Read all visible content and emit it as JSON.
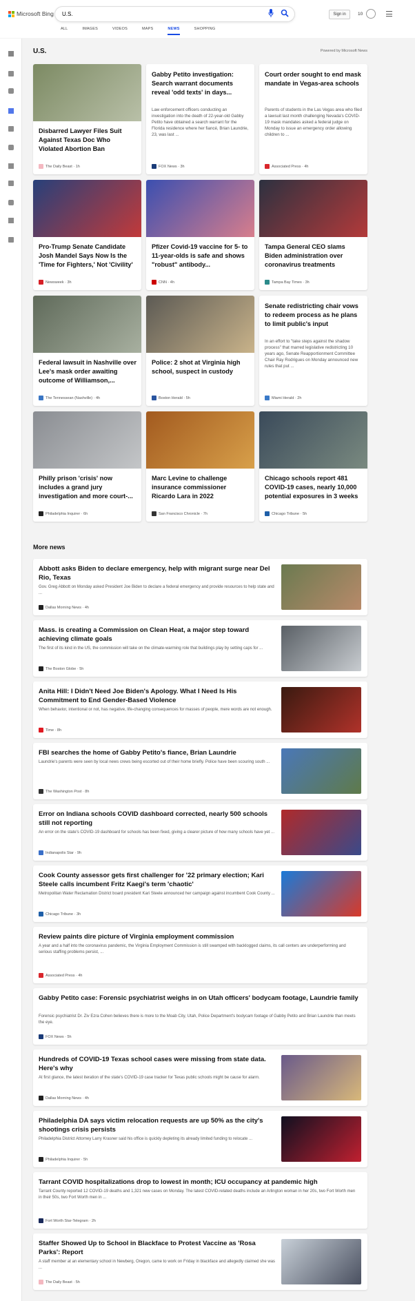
{
  "brand": {
    "name": "Microsoft Bing",
    "colors": [
      "#f25022",
      "#7fba00",
      "#00a4ef",
      "#ffb900"
    ]
  },
  "search": {
    "query": "U.S."
  },
  "header": {
    "signin_label": "Sign in",
    "points": "10"
  },
  "tabs": [
    {
      "label": "ALL"
    },
    {
      "label": "IMAGES"
    },
    {
      "label": "VIDEOS"
    },
    {
      "label": "MAPS"
    },
    {
      "label": "NEWS",
      "active": true
    },
    {
      "label": "SHOPPING"
    }
  ],
  "accent": "#174ae4",
  "rail_icons": [
    "chevron-right-icon",
    "home-icon",
    "sparkle-icon",
    "flag-icon",
    "pin-icon",
    "globe-icon",
    "flask-icon",
    "rocket-icon",
    "film-icon",
    "bank-icon",
    "card-icon"
  ],
  "section": {
    "title": "U.S.",
    "powered_by": "Powered by Microsoft News"
  },
  "top_cards": [
    {
      "title": "Disbarred Lawyer Files Suit Against Texas Doc Who Violated Abortion Ban",
      "source": "The Daily Beast",
      "time": "1h",
      "src_color": "#f4b8c0",
      "img_colors": [
        "#7c8a63",
        "#b9c0a8"
      ]
    },
    {
      "title": "Gabby Petito investigation: Search warrant documents reveal 'odd texts' in days...",
      "snippet": "Law enforcement officers conducting an investigation into the death of 22-year-old Gabby Petito have obtained a search warrant for the Florida residence where her fiancé, Brian Laundrie, 23, was last ...",
      "source": "FOX News",
      "time": "3h",
      "src_color": "#1a3b78"
    },
    {
      "title": "Court order sought to end mask mandate in Vegas-area schools",
      "snippet": "Parents of students in the Las Vegas area who filed a lawsuit last month challenging Nevada's COVID-19 mask mandates asked a federal judge on Monday to issue an emergency order allowing children to ...",
      "source": "Associated Press",
      "time": "4h",
      "src_color": "#d9262c"
    },
    {
      "title": "Pro-Trump Senate Candidate Josh Mandel Says Now Is the 'Time for Fighters,' Not 'Civility'",
      "source": "Newsweek",
      "time": "3h",
      "src_color": "#d61f26",
      "img_colors": [
        "#27407a",
        "#c23a3a"
      ]
    },
    {
      "title": "Pfizer Covid-19 vaccine for 5- to 11-year-olds is safe and shows \"robust\" antibody...",
      "source": "CNN",
      "time": "4h",
      "src_color": "#cc0000",
      "img_colors": [
        "#3b4fb0",
        "#d87e8c"
      ]
    },
    {
      "title": "Tampa General CEO slams Biden administration over coronavirus treatments",
      "source": "Tampa Bay Times",
      "time": "3h",
      "src_color": "#2c8b8b",
      "img_colors": [
        "#2d3140",
        "#b33a3a"
      ]
    },
    {
      "title": "Federal lawsuit in Nashville over Lee's mask order awaiting outcome of Williamson,...",
      "source": "The Tennessean (Nashville)",
      "time": "4h",
      "src_color": "#3a76c4",
      "img_colors": [
        "#5f6a5a",
        "#a8b0a0"
      ]
    },
    {
      "title": "Police: 2 shot at Virginia high school, suspect in custody",
      "source": "Boston Herald",
      "time": "5h",
      "src_color": "#2a55a0",
      "img_colors": [
        "#5c5a54",
        "#c9b38a"
      ]
    },
    {
      "title": "Senate redistricting chair vows to redeem process as he plans to limit public's input",
      "snippet": "In an effort to \"take steps against the shadow process\" that marred legislative redistricting 10 years ago, Senate Reapportionment Committee Chair Ray Rodrigues on Monday announced new rules that put ...",
      "source": "Miami Herald",
      "time": "2h",
      "src_color": "#3a7ac8"
    },
    {
      "title": "Philly prison 'crisis' now includes a grand jury investigation and more court-...",
      "source": "Philadelphia Inquirer",
      "time": "6h",
      "src_color": "#222222",
      "img_colors": [
        "#8a8d92",
        "#c4c6c8"
      ]
    },
    {
      "title": "Marc Levine to challenge insurance commissioner Ricardo Lara in 2022",
      "source": "San Francisco Chronicle",
      "time": "7h",
      "src_color": "#333333",
      "img_colors": [
        "#a25a1f",
        "#d8a04a"
      ]
    },
    {
      "title": "Chicago schools report 481 COVID-19 cases, nearly 10,000 potential exposures in 3 weeks",
      "source": "Chicago Tribune",
      "time": "5h",
      "src_color": "#1f5fa8",
      "img_colors": [
        "#3a4a5a",
        "#7a8a80"
      ]
    }
  ],
  "more_news": {
    "title": "More news",
    "items": [
      {
        "title": "Abbott asks Biden to declare emergency, help with migrant surge near Del Rio, Texas",
        "snippet": "Gov. Greg Abbott on Monday asked President Joe Biden to declare a federal emergency and provide resources to help state and ...",
        "source": "Dallas Morning News",
        "time": "4h",
        "src_color": "#222222",
        "img_colors": [
          "#6b7a50",
          "#b88a6a"
        ]
      },
      {
        "title": "Mass. is creating a Commission on Clean Heat, a major step toward achieving climate goals",
        "snippet": "The first of its kind in the US, the commission will take on the climate-warming role that buildings play by setting caps for ...",
        "source": "The Boston Globe",
        "time": "5h",
        "src_color": "#222222",
        "img_colors": [
          "#5a6066",
          "#c8ccd0"
        ]
      },
      {
        "title": "Anita Hill: I Didn't Need Joe Biden's Apology. What I Need Is His Commitment to End Gender-Based Violence",
        "snippet": "When behavior, intentional or not, has negative, life-changing consequences for masses of people, mere words are not enough.",
        "source": "Time",
        "time": "8h",
        "src_color": "#e01a22",
        "img_colors": [
          "#3a1a10",
          "#b0322a"
        ]
      },
      {
        "title": "FBI searches the home of Gabby Petito's fiance, Brian Laundrie",
        "snippet": "Laundrie's parents were seen by local news crews being escorted out of their home briefly. Police have been scouring south ...",
        "source": "The Washington Post",
        "time": "8h",
        "src_color": "#333333",
        "img_colors": [
          "#4a78b8",
          "#5f7a4a"
        ]
      },
      {
        "title": "Error on Indiana schools COVID dashboard corrected, nearly 500 schools still not reporting",
        "snippet": "An error on the state's COVID-19 dashboard for schools has been fixed, giving a clearer picture of how many schools have yet ...",
        "source": "Indianapolis Star",
        "time": "9h",
        "src_color": "#3a6fc8",
        "img_colors": [
          "#b02a2a",
          "#3a4a8a"
        ]
      },
      {
        "title": "Cook County assessor gets first challenger for '22 primary election; Kari Steele calls incumbent Fritz Kaegi's term 'chaotic'",
        "snippet": "Metropolitan Water Reclamation District board president Kari Steele announced her campaign against incumbent Cook County ...",
        "source": "Chicago Tribune",
        "time": "3h",
        "src_color": "#1f5fa8",
        "img_colors": [
          "#1a7ad8",
          "#d83a2a"
        ]
      },
      {
        "title": "Review paints dire picture of Virginia employment commission",
        "snippet": "A year and a half into the coronavirus pandemic, the Virginia Employment Commission is still swamped with backlogged claims, its call centers are underperforming and serious staffing problems persist, ...",
        "source": "Associated Press",
        "time": "4h",
        "src_color": "#d9262c"
      },
      {
        "title": "Gabby Petito case: Forensic psychiatrist weighs in on Utah officers' bodycam footage, Laundrie family",
        "snippet": "Forensic psychiatrist Dr. Ziv Ezra Cohen believes there is more to the Moab City, Utah, Police Department's bodycam footage of Gabby Petito and Brian Laundrie than meets the eye.",
        "source": "FOX News",
        "time": "5h",
        "src_color": "#1a3b78"
      },
      {
        "title": "Hundreds of COVID-19 Texas school cases were missing from state data. Here's why",
        "snippet": "At first glance, the latest iteration of the state's COVID-19 case tracker for Texas public schools might be cause for alarm.",
        "source": "Dallas Morning News",
        "time": "4h",
        "src_color": "#222222",
        "img_colors": [
          "#6a5a8a",
          "#d8b87a"
        ]
      },
      {
        "title": "Philadelphia DA says victim relocation requests are up 50% as the city's shootings crisis persists",
        "snippet": "Philadelphia District Attorney Larry Krasner said his office is quickly depleting its already limited funding to relocate ...",
        "source": "Philadelphia Inquirer",
        "time": "5h",
        "src_color": "#222222",
        "img_colors": [
          "#101020",
          "#c02030"
        ]
      },
      {
        "title": "Tarrant COVID hospitalizations drop to lowest in month; ICU occupancy at pandemic high",
        "snippet": "Tarrant County reported 12 COVID-19 deaths and 1,321 new cases on Monday. The latest COVID-related deaths include an Arlington woman in her 20s, two Fort Worth men in their 50s, two Fort Worth men in ...",
        "source": "Fort Worth Star-Telegram",
        "time": "2h",
        "src_color": "#1a2a5a"
      },
      {
        "title": "Staffer Showed Up to School in Blackface to Protest Vaccine as 'Rosa Parks': Report",
        "snippet": "A staff member at an elementary school in Newberg, Oregon, came to work on Friday in blackface and allegedly claimed she was ...",
        "source": "The Daily Beast",
        "time": "5h",
        "src_color": "#f4b8c0",
        "img_colors": [
          "#c8d0d8",
          "#4a5060"
        ]
      }
    ]
  }
}
